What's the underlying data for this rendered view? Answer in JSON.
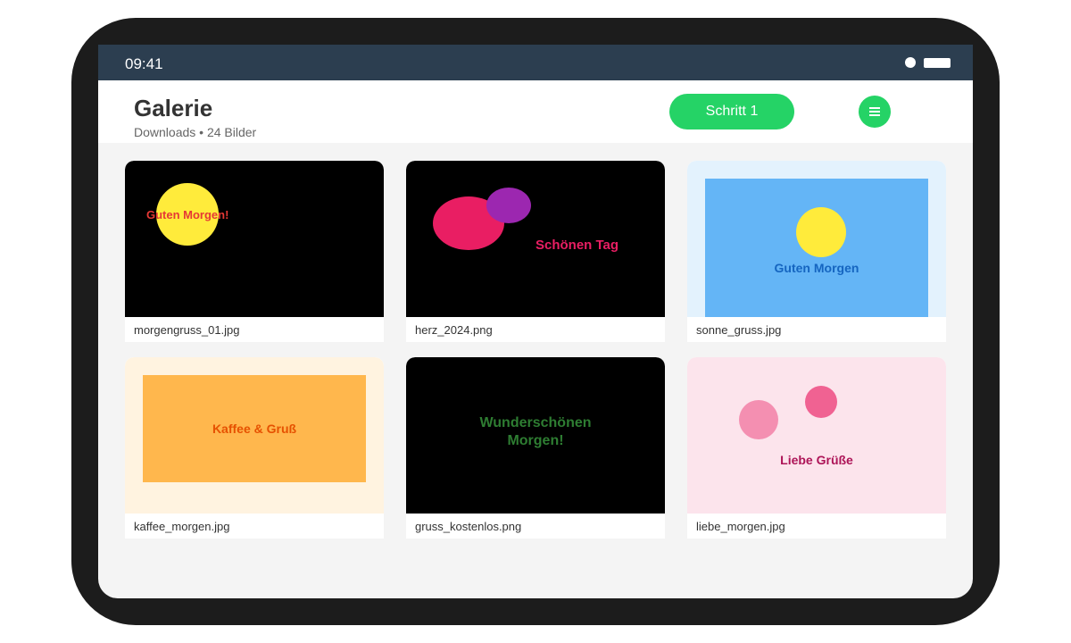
{
  "status_bar": {
    "time": "09:41"
  },
  "header": {
    "title": "Galerie",
    "subtitle": "Downloads • 24 Bilder",
    "step_button_label": "Schritt 1",
    "menu_icon": "hamburger-menu-icon"
  },
  "colors": {
    "status_bar": "#2c3e50",
    "accent": "#25d366",
    "screen_background": "#f4f4f4"
  },
  "gallery": {
    "items": [
      {
        "filename": "morgengruss_01.jpg",
        "thumb_text": "Guten Morgen!",
        "thumb_bg": "#000000",
        "thumb_text_color": "#e53935"
      },
      {
        "filename": "herz_2024.png",
        "thumb_text": "Schönen Tag",
        "thumb_bg": "#000000",
        "thumb_text_color": "#e91e63"
      },
      {
        "filename": "sonne_gruss.jpg",
        "thumb_text": "Guten Morgen",
        "thumb_bg": "#e3f2fd",
        "thumb_text_color": "#1565c0"
      },
      {
        "filename": "kaffee_morgen.jpg",
        "thumb_text": "Kaffee & Gruß",
        "thumb_bg": "#fff3e0",
        "thumb_text_color": "#e65100"
      },
      {
        "filename": "gruss_kostenlos.png",
        "thumb_text_line1": "Wunderschönen",
        "thumb_text_line2": "Morgen!",
        "thumb_bg": "#000000",
        "thumb_text_color": "#2e7d32"
      },
      {
        "filename": "liebe_morgen.jpg",
        "thumb_text": "Liebe Grüße",
        "thumb_bg": "#fce4ec",
        "thumb_text_color": "#ad1457"
      }
    ]
  }
}
